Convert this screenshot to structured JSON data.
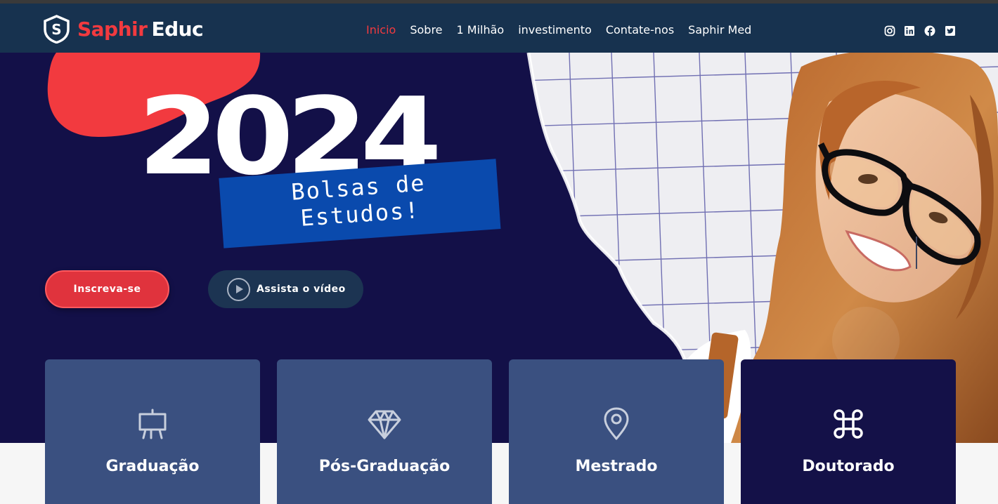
{
  "brand": {
    "name_part1": "Saphir",
    "name_part2": "Educ",
    "badge_letter": "S"
  },
  "nav": {
    "items": [
      {
        "label": "Inicio",
        "active": true
      },
      {
        "label": "Sobre",
        "active": false
      },
      {
        "label": "1 Milhão",
        "active": false
      },
      {
        "label": "investimento",
        "active": false
      },
      {
        "label": "Contate-nos",
        "active": false
      },
      {
        "label": "Saphir Med",
        "active": false
      }
    ]
  },
  "social": [
    "instagram-icon",
    "linkedin-icon",
    "facebook-icon",
    "twitter-icon"
  ],
  "hero": {
    "year": "2024",
    "banner_line1": "Bolsas de",
    "banner_line2": "Estudos!",
    "cta_primary": "Inscreva-se",
    "cta_secondary": "Assista o vídeo"
  },
  "cards": [
    {
      "title": "Graduação",
      "icon": "easel-icon"
    },
    {
      "title": "Pós-Graduação",
      "icon": "diamond-icon"
    },
    {
      "title": "Mestrado",
      "icon": "map-pin-icon"
    },
    {
      "title": "Doutorado",
      "icon": "command-icon"
    }
  ],
  "colors": {
    "navbar": "#17324f",
    "hero_bg": "#131048",
    "accent_red": "#f23a3f",
    "banner_blue": "#0a4aad",
    "card_blue": "#3a5080",
    "card_dark": "#141148"
  }
}
